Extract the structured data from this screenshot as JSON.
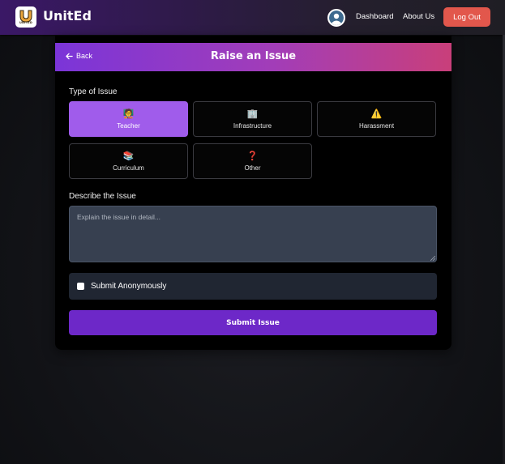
{
  "navbar": {
    "logo_subtext": "UNITED",
    "brand": "UnitEd",
    "links": [
      "Dashboard",
      "About Us"
    ],
    "logout_label": "Log Out",
    "brand_gradient": [
      "#3a1866",
      "#1f1e24"
    ]
  },
  "card": {
    "back_label": "Back",
    "title": "Raise an Issue",
    "type_label": "Type of Issue",
    "issue_types": [
      {
        "label": "Teacher",
        "icon": "teacher-icon",
        "glyph": "🧑‍🏫",
        "selected": true
      },
      {
        "label": "Infrastructure",
        "icon": "building-icon",
        "glyph": "🏢",
        "selected": false
      },
      {
        "label": "Harassment",
        "icon": "warning-icon",
        "glyph": "⚠️",
        "selected": false
      },
      {
        "label": "Curriculum",
        "icon": "books-icon",
        "glyph": "📚",
        "selected": false
      },
      {
        "label": "Other",
        "icon": "question-icon",
        "glyph": "❓",
        "selected": false
      }
    ],
    "describe_label": "Describe the Issue",
    "describe_placeholder": "Explain the issue in detail...",
    "describe_value": "",
    "anonymous_label": "Submit Anonymously",
    "anonymous_checked": false,
    "submit_label": "Submit Issue"
  },
  "colors": {
    "accent_selected": "#a05ceb",
    "submit": "#6d28c8",
    "logout": "#e2574c",
    "header_gradient": [
      "#7b35d8",
      "#c93f7a"
    ]
  }
}
